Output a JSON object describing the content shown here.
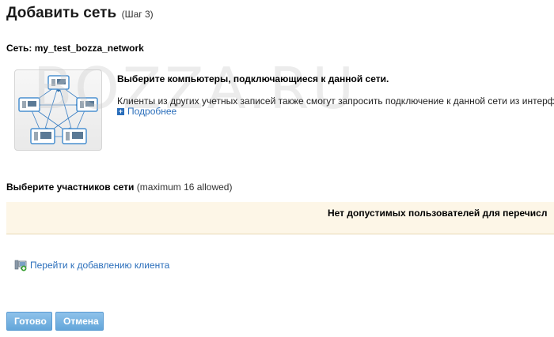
{
  "header": {
    "title": "Добавить сеть",
    "step": "(Шаг 3)"
  },
  "network": {
    "label": "Сеть: my_test_bozza_network"
  },
  "info": {
    "heading": "Выберите компьютеры, подключающиеся к данной сети.",
    "text": "Клиенты из других учетных записей также смогут запросить подключение к данной сети из интерф",
    "more_link": "Подробнее"
  },
  "watermark": "BOZZA.RU",
  "members": {
    "label": "Выберите участников сети",
    "max": "(maximum 16 allowed)"
  },
  "empty_state": {
    "message": "Нет допустимых пользователей для перечисл"
  },
  "actions": {
    "add_client": "Перейти к добавлению клиента",
    "done": "Готово",
    "cancel": "Отмена"
  },
  "colors": {
    "link": "#2a6ebb",
    "button": "#63a6da",
    "panel": "#fdf6e7"
  }
}
